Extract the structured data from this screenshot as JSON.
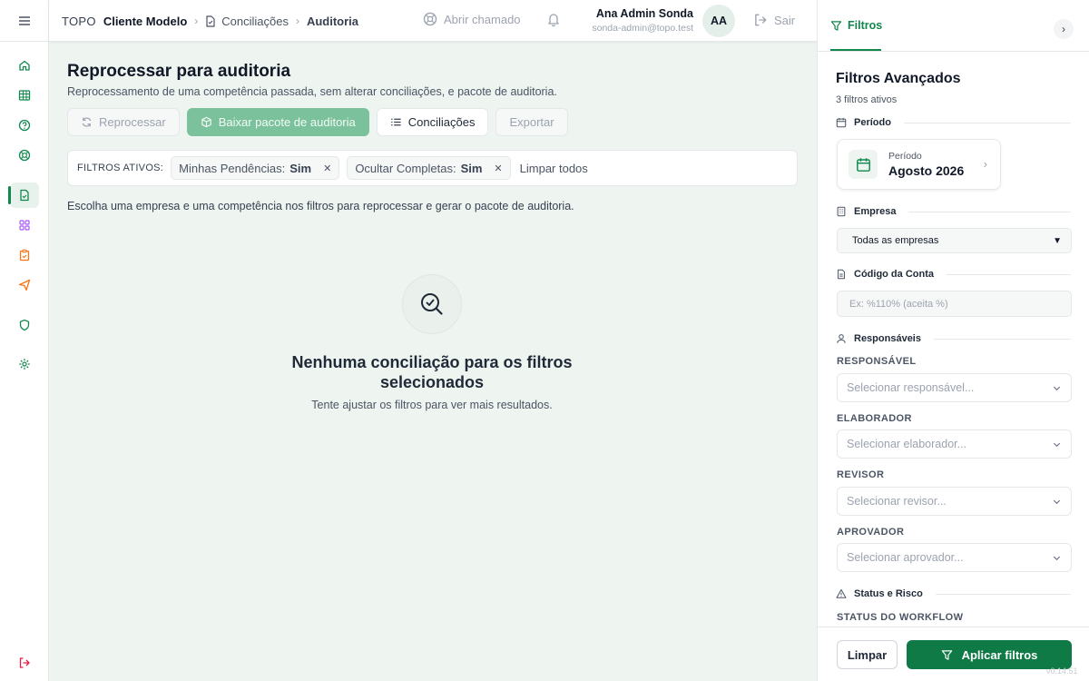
{
  "header": {
    "brand": "TOPO",
    "client": "Cliente Modelo",
    "breadcrumb": [
      "Conciliações",
      "Auditoria"
    ],
    "ticket_label": "Abrir chamado",
    "user_name": "Ana Admin Sonda",
    "user_email": "sonda-admin@topo.test",
    "avatar_initials": "AA",
    "logout_label": "Sair"
  },
  "sidebar": {
    "items": [
      {
        "icon": "home-icon",
        "color": "#11874e"
      },
      {
        "icon": "grid-icon",
        "color": "#11874e"
      },
      {
        "icon": "help-icon",
        "color": "#11874e"
      },
      {
        "icon": "lifebuoy-icon",
        "color": "#11874e"
      },
      {
        "icon": "document-icon",
        "color": "#11874e",
        "active": true
      },
      {
        "icon": "apps-icon",
        "color": "#a855f7"
      },
      {
        "icon": "clipboard-icon",
        "color": "#f97316"
      },
      {
        "icon": "send-icon",
        "color": "#f97316"
      },
      {
        "icon": "shield-icon",
        "color": "#11874e"
      },
      {
        "icon": "settings-icon",
        "color": "#11874e"
      },
      {
        "icon": "logout-icon",
        "color": "#e11d48"
      }
    ]
  },
  "page": {
    "title": "Reprocessar para auditoria",
    "subtitle": "Reprocessamento de uma competência passada, sem alterar conciliações, e pacote de auditoria.",
    "actions": {
      "reprocess": "Reprocessar",
      "download": "Baixar pacote de auditoria",
      "conciliations": "Conciliações",
      "export": "Exportar"
    },
    "filters": {
      "label": "FILTROS ATIVOS:",
      "chips": [
        {
          "name": "Minhas Pendências:",
          "value": "Sim"
        },
        {
          "name": "Ocultar Completas:",
          "value": "Sim"
        }
      ],
      "clear_all": "Limpar todos"
    },
    "hint": "Escolha uma empresa e uma competência nos filtros para reprocessar e gerar o pacote de auditoria.",
    "empty": {
      "title": "Nenhuma conciliação para os filtros selecionados",
      "subtitle": "Tente ajustar os filtros para ver mais resultados."
    }
  },
  "panel": {
    "tab": "Filtros",
    "title": "Filtros Avançados",
    "count": "3 filtros ativos",
    "period": {
      "section": "Período",
      "label": "Período",
      "value": "Agosto 2026"
    },
    "company": {
      "section": "Empresa",
      "value": "Todas as empresas"
    },
    "account": {
      "section": "Código da Conta",
      "placeholder": "Ex: %110% (aceita %)"
    },
    "responsibles": {
      "section": "Responsáveis",
      "fields": [
        {
          "label": "RESPONSÁVEL",
          "placeholder": "Selecionar responsável..."
        },
        {
          "label": "ELABORADOR",
          "placeholder": "Selecionar elaborador..."
        },
        {
          "label": "REVISOR",
          "placeholder": "Selecionar revisor..."
        },
        {
          "label": "APROVADOR",
          "placeholder": "Selecionar aprovador..."
        }
      ]
    },
    "status": {
      "section": "Status e Risco",
      "workflow_label": "STATUS DO WORKFLOW"
    },
    "clear_button": "Limpar",
    "apply_button": "Aplicar filtros",
    "version": "v0.14.51"
  },
  "colors": {
    "accent": "#11874e",
    "accent_light": "#7bc19b",
    "background": "#eef4f0"
  }
}
